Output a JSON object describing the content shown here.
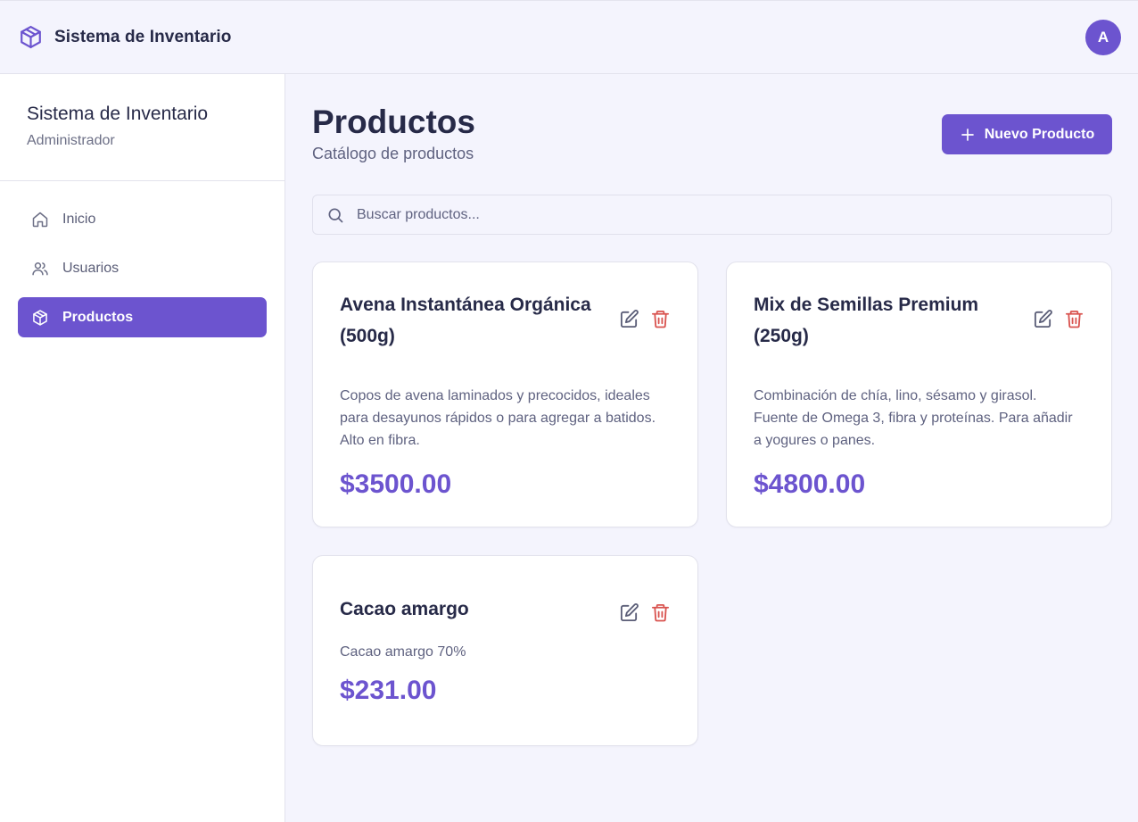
{
  "topbar": {
    "title": "Sistema de Inventario",
    "avatar_initial": "A"
  },
  "sidebar": {
    "title": "Sistema de Inventario",
    "subtitle": "Administrador",
    "items": [
      {
        "label": "Inicio",
        "icon": "home-icon"
      },
      {
        "label": "Usuarios",
        "icon": "users-icon"
      },
      {
        "label": "Productos",
        "icon": "package-icon",
        "active": true
      }
    ]
  },
  "main": {
    "title": "Productos",
    "subtitle": "Catálogo de productos",
    "new_button_label": "Nuevo Producto",
    "search": {
      "placeholder": "Buscar productos...",
      "value": ""
    },
    "products": [
      {
        "name": "Avena Instantánea Orgánica (500g)",
        "description": "Copos de avena laminados y precocidos, ideales para desayunos rápidos o para agregar a batidos. Alto en fibra.",
        "price": "$3500.00"
      },
      {
        "name": "Mix de Semillas Premium (250g)",
        "description": "Combinación de chía, lino, sésamo y girasol. Fuente de Omega 3, fibra y proteínas. Para añadir a yogures o panes.",
        "price": "$4800.00"
      },
      {
        "name": "Cacao amargo",
        "description": "Cacao amargo 70%",
        "price": "$231.00"
      }
    ]
  },
  "colors": {
    "accent": "#6c54cf",
    "danger": "#d9534f",
    "text": "#272a48",
    "muted": "#5f6280"
  }
}
